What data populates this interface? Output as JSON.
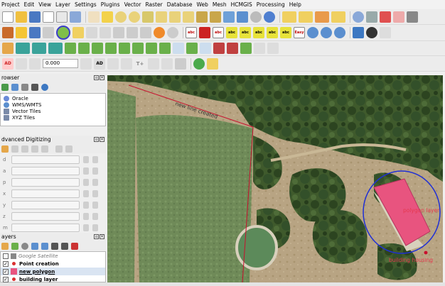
{
  "menubar": [
    "Project",
    "Edit",
    "View",
    "Layer",
    "Settings",
    "Plugins",
    "Vector",
    "Raster",
    "Database",
    "Web",
    "Mesh",
    "HCMGIS",
    "Processing",
    "Help"
  ],
  "attr_toolbar": {
    "opacity_value": "0.000",
    "ad_label": "AD",
    "text_tool_label": "T+"
  },
  "browser": {
    "title": "rowser",
    "items": [
      "Oracle",
      "WMS/WMTS",
      "Vector Tiles",
      "XYZ Tiles"
    ]
  },
  "digitizing": {
    "title": "dvanced Digitizing",
    "fields": [
      "d",
      "a",
      "p",
      "x",
      "y",
      "z",
      "m"
    ]
  },
  "layers": {
    "title": "ayers",
    "items": [
      {
        "name": "Google Satellite",
        "checked": false,
        "style": "italic"
      },
      {
        "name": "Point creation",
        "checked": true,
        "style": "bold"
      },
      {
        "name": "new polygon",
        "checked": true,
        "style": "bold-underline"
      },
      {
        "name": "building layer",
        "checked": true,
        "style": "bold"
      }
    ]
  },
  "map": {
    "line_label": "new line created",
    "polygon_label": "polygon layer",
    "building_label": "building housing",
    "accent_red": "#c8102e",
    "polygon_fill": "#e8547f",
    "circle_blue": "#1f2fd6"
  }
}
